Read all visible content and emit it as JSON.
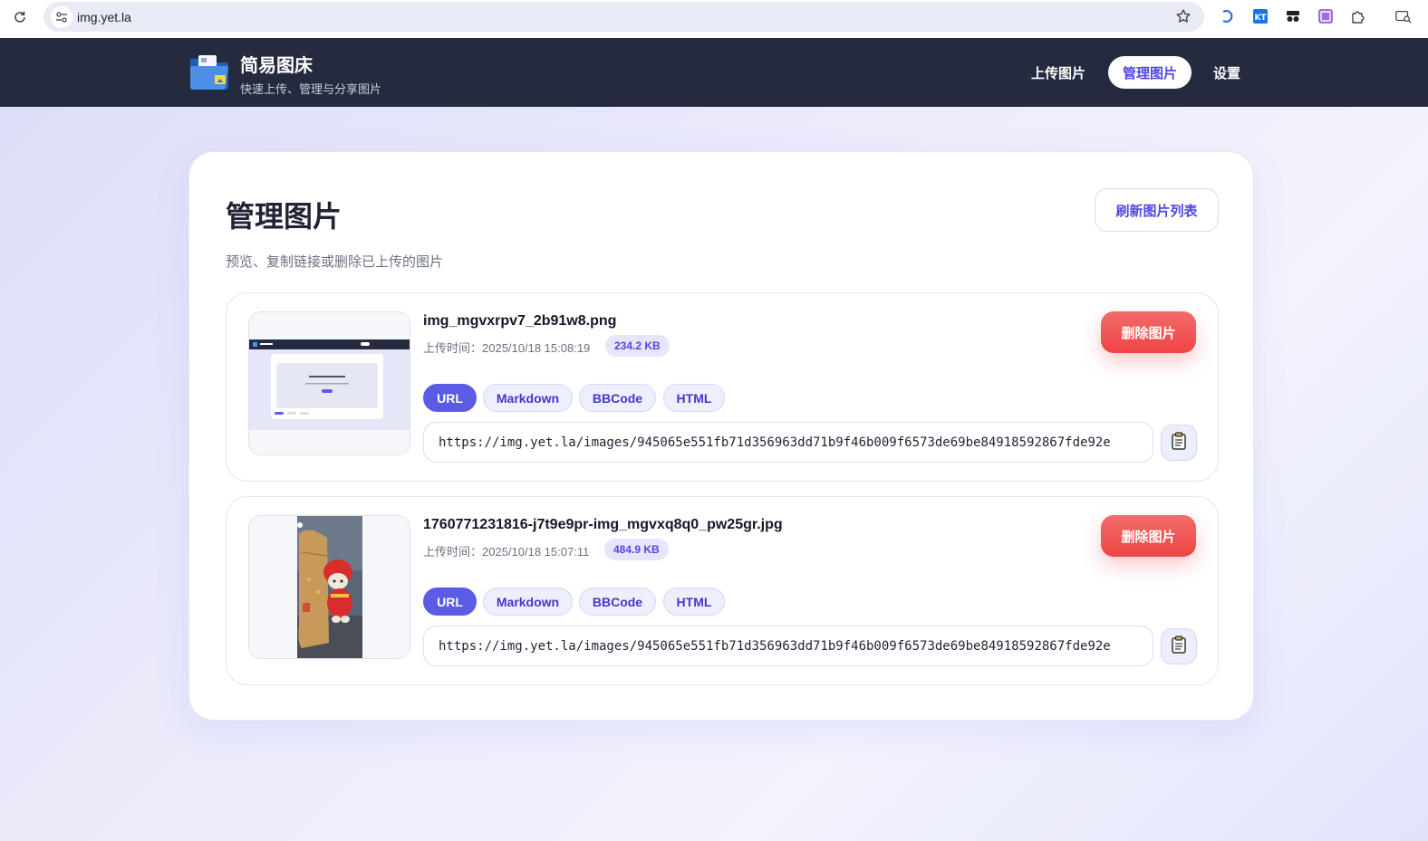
{
  "browser": {
    "url": "img.yet.la"
  },
  "header": {
    "title": "简易图床",
    "subtitle": "快速上传、管理与分享图片",
    "nav": {
      "upload": "上传图片",
      "manage": "管理图片",
      "settings": "设置"
    }
  },
  "page": {
    "title": "管理图片",
    "description": "预览、复制链接或删除已上传的图片",
    "refresh_label": "刷新图片列表"
  },
  "images": [
    {
      "name": "img_mgvxrpv7_2b91w8.png",
      "upload_time": "上传时间：2025/10/18 15:08:19",
      "size": "234.2 KB",
      "delete_label": "删除图片",
      "formats": [
        "URL",
        "Markdown",
        "BBCode",
        "HTML"
      ],
      "active_format": "URL",
      "link": "https://img.yet.la/images/945065e551fb71d356963dd71b9f46b009f6573de69be84918592867fde92e"
    },
    {
      "name": "1760771231816-j7t9e9pr-img_mgvxq8q0_pw25gr.jpg",
      "upload_time": "上传时间：2025/10/18 15:07:11",
      "size": "484.9 KB",
      "delete_label": "删除图片",
      "formats": [
        "URL",
        "Markdown",
        "BBCode",
        "HTML"
      ],
      "active_format": "URL",
      "link": "https://img.yet.la/images/945065e551fb71d356963dd71b9f46b009f6573de69be84918592867fde92e"
    }
  ],
  "colors": {
    "accent": "#4f46e5",
    "header_bg": "#252b3f",
    "danger": "#ef4444"
  }
}
